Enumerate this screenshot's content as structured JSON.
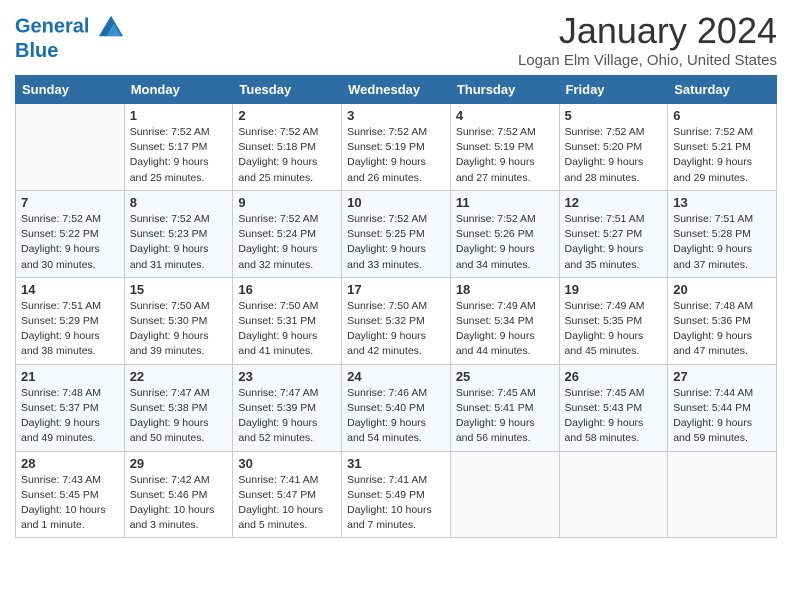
{
  "header": {
    "logo_line1": "General",
    "logo_line2": "Blue",
    "title": "January 2024",
    "location": "Logan Elm Village, Ohio, United States"
  },
  "weekdays": [
    "Sunday",
    "Monday",
    "Tuesday",
    "Wednesday",
    "Thursday",
    "Friday",
    "Saturday"
  ],
  "weeks": [
    [
      {
        "num": "",
        "sunrise": "",
        "sunset": "",
        "daylight": "",
        "empty": true
      },
      {
        "num": "1",
        "sunrise": "Sunrise: 7:52 AM",
        "sunset": "Sunset: 5:17 PM",
        "daylight": "Daylight: 9 hours and 25 minutes."
      },
      {
        "num": "2",
        "sunrise": "Sunrise: 7:52 AM",
        "sunset": "Sunset: 5:18 PM",
        "daylight": "Daylight: 9 hours and 25 minutes."
      },
      {
        "num": "3",
        "sunrise": "Sunrise: 7:52 AM",
        "sunset": "Sunset: 5:19 PM",
        "daylight": "Daylight: 9 hours and 26 minutes."
      },
      {
        "num": "4",
        "sunrise": "Sunrise: 7:52 AM",
        "sunset": "Sunset: 5:19 PM",
        "daylight": "Daylight: 9 hours and 27 minutes."
      },
      {
        "num": "5",
        "sunrise": "Sunrise: 7:52 AM",
        "sunset": "Sunset: 5:20 PM",
        "daylight": "Daylight: 9 hours and 28 minutes."
      },
      {
        "num": "6",
        "sunrise": "Sunrise: 7:52 AM",
        "sunset": "Sunset: 5:21 PM",
        "daylight": "Daylight: 9 hours and 29 minutes."
      }
    ],
    [
      {
        "num": "7",
        "sunrise": "Sunrise: 7:52 AM",
        "sunset": "Sunset: 5:22 PM",
        "daylight": "Daylight: 9 hours and 30 minutes."
      },
      {
        "num": "8",
        "sunrise": "Sunrise: 7:52 AM",
        "sunset": "Sunset: 5:23 PM",
        "daylight": "Daylight: 9 hours and 31 minutes."
      },
      {
        "num": "9",
        "sunrise": "Sunrise: 7:52 AM",
        "sunset": "Sunset: 5:24 PM",
        "daylight": "Daylight: 9 hours and 32 minutes."
      },
      {
        "num": "10",
        "sunrise": "Sunrise: 7:52 AM",
        "sunset": "Sunset: 5:25 PM",
        "daylight": "Daylight: 9 hours and 33 minutes."
      },
      {
        "num": "11",
        "sunrise": "Sunrise: 7:52 AM",
        "sunset": "Sunset: 5:26 PM",
        "daylight": "Daylight: 9 hours and 34 minutes."
      },
      {
        "num": "12",
        "sunrise": "Sunrise: 7:51 AM",
        "sunset": "Sunset: 5:27 PM",
        "daylight": "Daylight: 9 hours and 35 minutes."
      },
      {
        "num": "13",
        "sunrise": "Sunrise: 7:51 AM",
        "sunset": "Sunset: 5:28 PM",
        "daylight": "Daylight: 9 hours and 37 minutes."
      }
    ],
    [
      {
        "num": "14",
        "sunrise": "Sunrise: 7:51 AM",
        "sunset": "Sunset: 5:29 PM",
        "daylight": "Daylight: 9 hours and 38 minutes."
      },
      {
        "num": "15",
        "sunrise": "Sunrise: 7:50 AM",
        "sunset": "Sunset: 5:30 PM",
        "daylight": "Daylight: 9 hours and 39 minutes."
      },
      {
        "num": "16",
        "sunrise": "Sunrise: 7:50 AM",
        "sunset": "Sunset: 5:31 PM",
        "daylight": "Daylight: 9 hours and 41 minutes."
      },
      {
        "num": "17",
        "sunrise": "Sunrise: 7:50 AM",
        "sunset": "Sunset: 5:32 PM",
        "daylight": "Daylight: 9 hours and 42 minutes."
      },
      {
        "num": "18",
        "sunrise": "Sunrise: 7:49 AM",
        "sunset": "Sunset: 5:34 PM",
        "daylight": "Daylight: 9 hours and 44 minutes."
      },
      {
        "num": "19",
        "sunrise": "Sunrise: 7:49 AM",
        "sunset": "Sunset: 5:35 PM",
        "daylight": "Daylight: 9 hours and 45 minutes."
      },
      {
        "num": "20",
        "sunrise": "Sunrise: 7:48 AM",
        "sunset": "Sunset: 5:36 PM",
        "daylight": "Daylight: 9 hours and 47 minutes."
      }
    ],
    [
      {
        "num": "21",
        "sunrise": "Sunrise: 7:48 AM",
        "sunset": "Sunset: 5:37 PM",
        "daylight": "Daylight: 9 hours and 49 minutes."
      },
      {
        "num": "22",
        "sunrise": "Sunrise: 7:47 AM",
        "sunset": "Sunset: 5:38 PM",
        "daylight": "Daylight: 9 hours and 50 minutes."
      },
      {
        "num": "23",
        "sunrise": "Sunrise: 7:47 AM",
        "sunset": "Sunset: 5:39 PM",
        "daylight": "Daylight: 9 hours and 52 minutes."
      },
      {
        "num": "24",
        "sunrise": "Sunrise: 7:46 AM",
        "sunset": "Sunset: 5:40 PM",
        "daylight": "Daylight: 9 hours and 54 minutes."
      },
      {
        "num": "25",
        "sunrise": "Sunrise: 7:45 AM",
        "sunset": "Sunset: 5:41 PM",
        "daylight": "Daylight: 9 hours and 56 minutes."
      },
      {
        "num": "26",
        "sunrise": "Sunrise: 7:45 AM",
        "sunset": "Sunset: 5:43 PM",
        "daylight": "Daylight: 9 hours and 58 minutes."
      },
      {
        "num": "27",
        "sunrise": "Sunrise: 7:44 AM",
        "sunset": "Sunset: 5:44 PM",
        "daylight": "Daylight: 9 hours and 59 minutes."
      }
    ],
    [
      {
        "num": "28",
        "sunrise": "Sunrise: 7:43 AM",
        "sunset": "Sunset: 5:45 PM",
        "daylight": "Daylight: 10 hours and 1 minute."
      },
      {
        "num": "29",
        "sunrise": "Sunrise: 7:42 AM",
        "sunset": "Sunset: 5:46 PM",
        "daylight": "Daylight: 10 hours and 3 minutes."
      },
      {
        "num": "30",
        "sunrise": "Sunrise: 7:41 AM",
        "sunset": "Sunset: 5:47 PM",
        "daylight": "Daylight: 10 hours and 5 minutes."
      },
      {
        "num": "31",
        "sunrise": "Sunrise: 7:41 AM",
        "sunset": "Sunset: 5:49 PM",
        "daylight": "Daylight: 10 hours and 7 minutes."
      },
      {
        "num": "",
        "sunrise": "",
        "sunset": "",
        "daylight": "",
        "empty": true
      },
      {
        "num": "",
        "sunrise": "",
        "sunset": "",
        "daylight": "",
        "empty": true
      },
      {
        "num": "",
        "sunrise": "",
        "sunset": "",
        "daylight": "",
        "empty": true
      }
    ]
  ]
}
